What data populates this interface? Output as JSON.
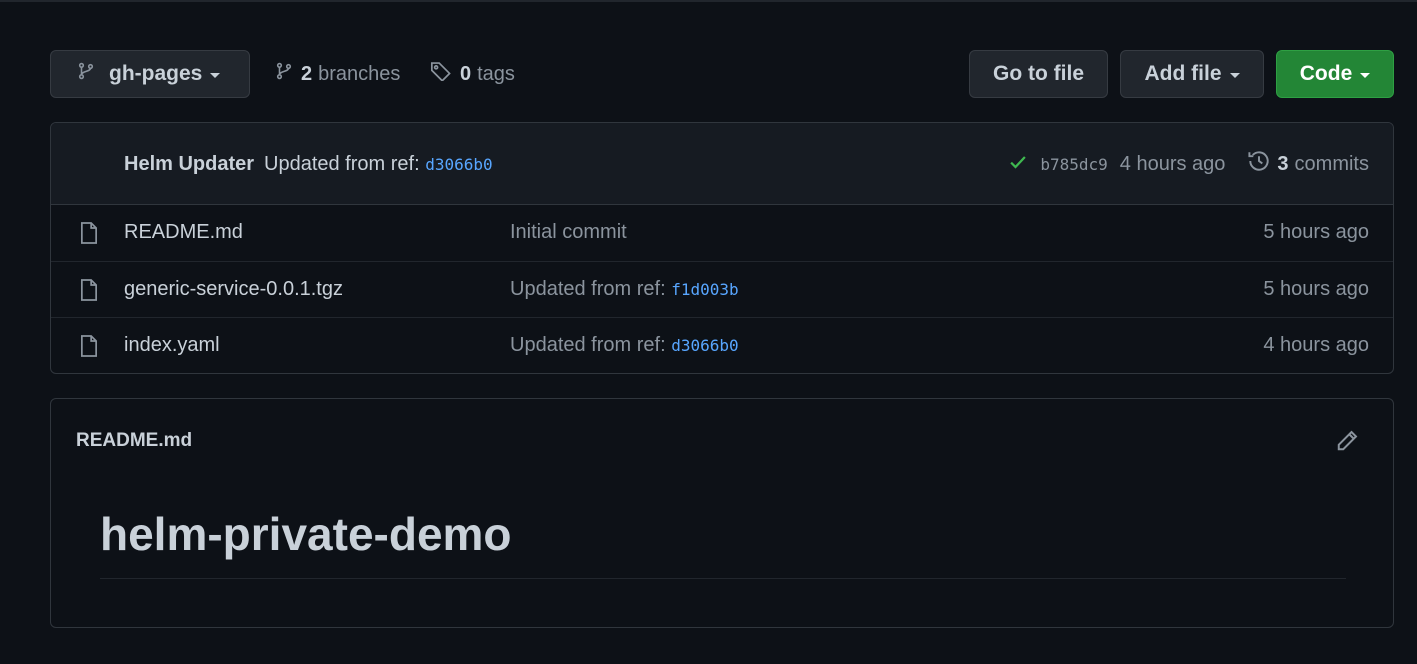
{
  "toolbar": {
    "branch_name": "gh-pages",
    "branches_count": "2",
    "branches_label": "branches",
    "tags_count": "0",
    "tags_label": "tags",
    "go_to_file_label": "Go to file",
    "add_file_label": "Add file",
    "code_label": "Code"
  },
  "latest_commit": {
    "author": "Helm Updater",
    "message": "Updated from ref:",
    "ref": "d3066b0",
    "sha": "b785dc9",
    "time": "4 hours ago",
    "commits_count": "3",
    "commits_label": "commits"
  },
  "files": [
    {
      "name": "README.md",
      "message": "Initial commit",
      "ref": "",
      "age": "5 hours ago"
    },
    {
      "name": "generic-service-0.0.1.tgz",
      "message": "Updated from ref:",
      "ref": "f1d003b",
      "age": "5 hours ago"
    },
    {
      "name": "index.yaml",
      "message": "Updated from ref:",
      "ref": "d3066b0",
      "age": "4 hours ago"
    }
  ],
  "readme": {
    "file_label": "README.md",
    "heading": "helm-private-demo"
  },
  "colors": {
    "background": "#0d1117",
    "accent_link": "#58a6ff",
    "success": "#3fb950",
    "primary_button": "#238636"
  }
}
